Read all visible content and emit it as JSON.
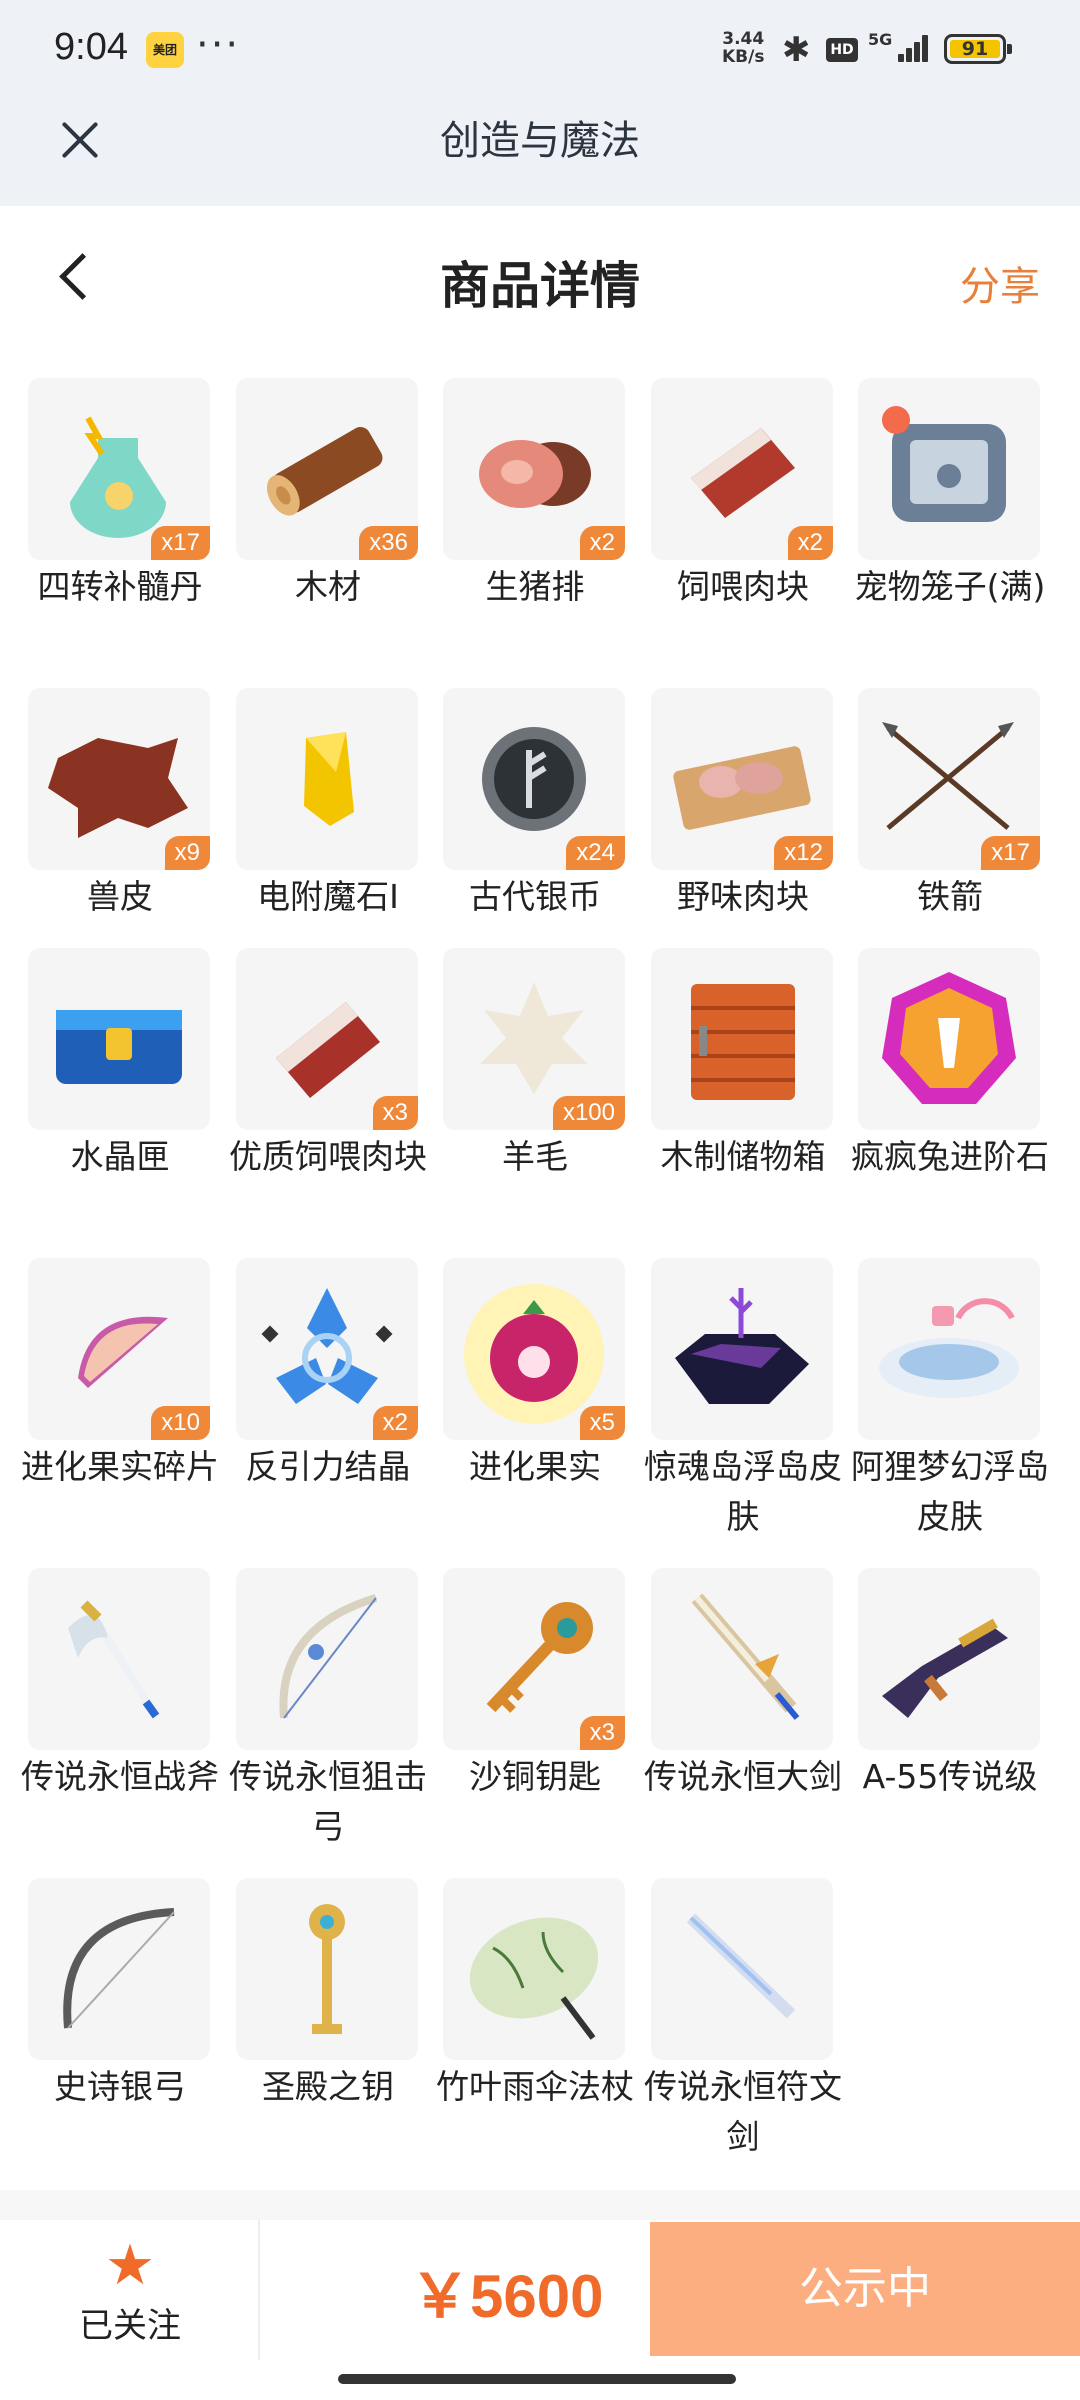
{
  "status_bar": {
    "time": "9:04",
    "app_badge": "美团",
    "net_speed_value": "3.44",
    "net_speed_unit": "KB/s",
    "hd": "HD",
    "network": "5G",
    "battery": "91"
  },
  "app_header": {
    "title": "创造与魔法",
    "close_icon": "close-icon"
  },
  "page_header": {
    "title": "商品详情",
    "share_label": "分享",
    "back_icon": "chevron-left-icon"
  },
  "items": [
    {
      "name": "四转补髓丹",
      "qty": "x17",
      "icon": "potion-flask"
    },
    {
      "name": "木材",
      "qty": "x36",
      "icon": "wood-log"
    },
    {
      "name": "生猪排",
      "qty": "x2",
      "icon": "raw-pork"
    },
    {
      "name": "饲喂肉块",
      "qty": "x2",
      "icon": "meat-chunk"
    },
    {
      "name": "宠物笼子(满)",
      "qty": "",
      "icon": "pet-cage"
    },
    {
      "name": "兽皮",
      "qty": "x9",
      "icon": "animal-hide"
    },
    {
      "name": "电附魔石I",
      "qty": "",
      "icon": "enchant-stone"
    },
    {
      "name": "古代银币",
      "qty": "x24",
      "icon": "silver-coin"
    },
    {
      "name": "野味肉块",
      "qty": "x12",
      "icon": "game-meat"
    },
    {
      "name": "铁箭",
      "qty": "x17",
      "icon": "iron-arrows"
    },
    {
      "name": "水晶匣",
      "qty": "",
      "icon": "crystal-chest"
    },
    {
      "name": "优质饲喂肉块",
      "qty": "x3",
      "icon": "premium-meat"
    },
    {
      "name": "羊毛",
      "qty": "x100",
      "icon": "wool"
    },
    {
      "name": "木制储物箱",
      "qty": "",
      "icon": "wooden-box"
    },
    {
      "name": "疯疯兔进阶石",
      "qty": "",
      "icon": "rabbit-stone"
    },
    {
      "name": "进化果实碎片",
      "qty": "x10",
      "icon": "fruit-shard"
    },
    {
      "name": "反引力结晶",
      "qty": "x2",
      "icon": "antigravity-crystal"
    },
    {
      "name": "进化果实",
      "qty": "x5",
      "icon": "evolution-fruit"
    },
    {
      "name": "惊魂岛浮岛皮肤",
      "qty": "",
      "icon": "dark-island"
    },
    {
      "name": "阿狸梦幻浮岛皮肤",
      "qty": "",
      "icon": "dream-island"
    },
    {
      "name": "传说永恒战斧",
      "qty": "",
      "icon": "battle-axe"
    },
    {
      "name": "传说永恒狙击弓",
      "qty": "",
      "icon": "sniper-bow"
    },
    {
      "name": "沙铜钥匙",
      "qty": "x3",
      "icon": "bronze-key"
    },
    {
      "name": "传说永恒大剑",
      "qty": "",
      "icon": "greatsword"
    },
    {
      "name": "A-55传说级",
      "qty": "",
      "icon": "rifle"
    },
    {
      "name": "史诗银弓",
      "qty": "",
      "icon": "silver-bow"
    },
    {
      "name": "圣殿之钥",
      "qty": "",
      "icon": "temple-key"
    },
    {
      "name": "竹叶雨伞法杖",
      "qty": "",
      "icon": "umbrella-staff"
    },
    {
      "name": "传说永恒符文剑",
      "qty": "",
      "icon": "rune-sword"
    }
  ],
  "footer": {
    "follow_label": "已关注",
    "follow_icon": "star-icon",
    "price": "￥5600",
    "status_label": "公示中"
  },
  "colors": {
    "accent": "#f06a2a",
    "status_button": "#fdae80",
    "badge": "#f0883a",
    "header_bg": "#eef2f7"
  }
}
